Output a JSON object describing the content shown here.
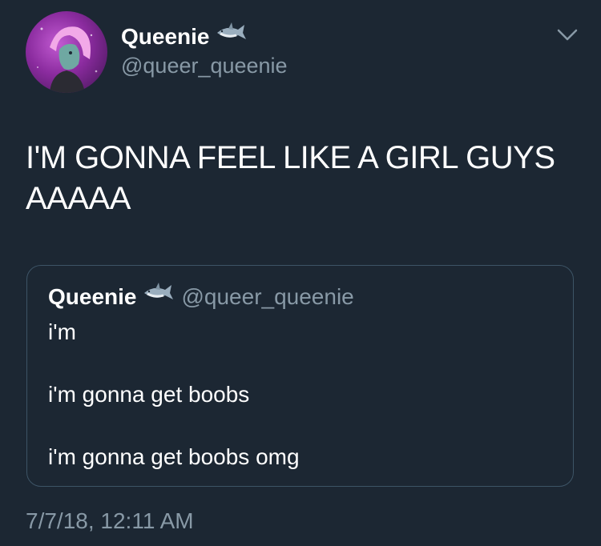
{
  "author": {
    "display_name": "Queenie",
    "handle": "@queer_queenie",
    "badge_icon": "shark-emoji",
    "avatar_colors": [
      "#c25bd2",
      "#8a2b9e",
      "#3e1450"
    ]
  },
  "tweet": {
    "text": "I'M GONNA FEEL LIKE A GIRL GUYS AAAAA",
    "timestamp": "7/7/18, 12:11 AM"
  },
  "quoted_tweet": {
    "display_name": "Queenie",
    "handle": "@queer_queenie",
    "badge_icon": "shark-emoji",
    "lines": [
      "i'm",
      "i'm gonna get boobs",
      "i'm gonna get boobs omg"
    ]
  },
  "menu_icon": "chevron-down-icon",
  "colors": {
    "background": "#1c2733",
    "text": "#ffffff",
    "secondary_text": "#8899a6",
    "border": "#3d5466"
  }
}
